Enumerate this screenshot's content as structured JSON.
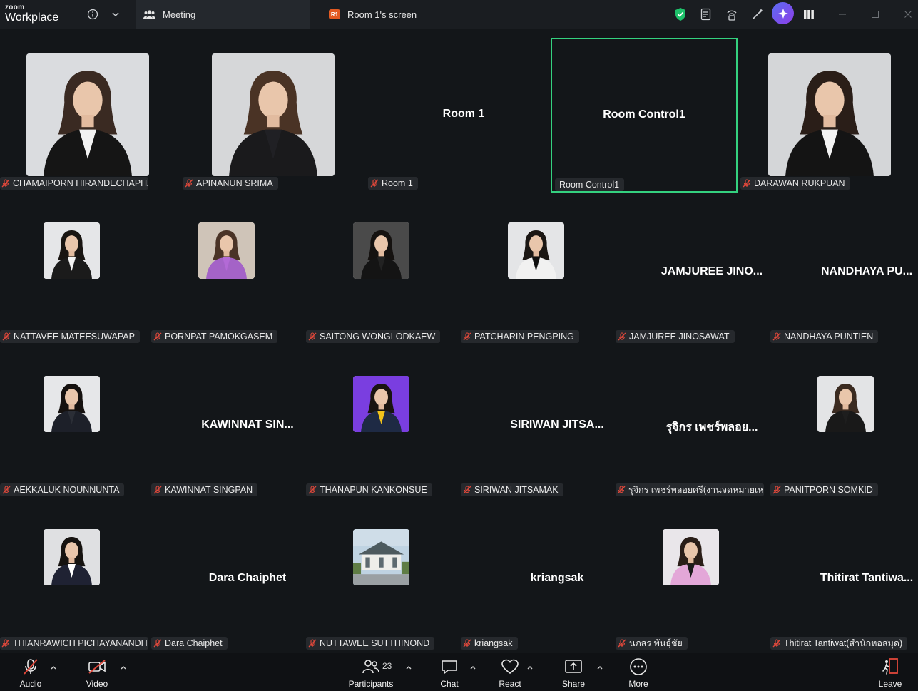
{
  "app": {
    "brand_top": "zoom",
    "brand_bottom": "Workplace",
    "tab_meeting": "Meeting",
    "tab_screen_badge": "R1",
    "tab_screen": "Room 1's screen"
  },
  "colors": {
    "highlight": "#34d17f",
    "muted_mic": "#e0483b",
    "background": "#131619"
  },
  "tiles": {
    "t1": {
      "label": "CHAMAIPORN HIRANDECHAPHAT"
    },
    "t2": {
      "label": "APINANUN SRIMA"
    },
    "t3": {
      "label": "Room 1",
      "center": "Room 1"
    },
    "t4": {
      "label": "Room Control1",
      "center": "Room Control1"
    },
    "t5": {
      "label": "DARAWAN RUKPUAN"
    },
    "t6": {
      "label": "NATTAVEE MATEESUWAPAP"
    },
    "t7": {
      "label": "PORNPAT PAMOKGASEM"
    },
    "t8": {
      "label": "SAITONG WONGLODKAEW"
    },
    "t9": {
      "label": "PATCHARIN PENGPING"
    },
    "t10": {
      "label": "JAMJUREE JINOSAWAT",
      "center": "JAMJUREE JINO..."
    },
    "t11": {
      "label": "NANDHAYA PUNTIEN",
      "center": "NANDHAYA  PU..."
    },
    "t12": {
      "label": "AEKKALUK NOUNNUNTA"
    },
    "t13": {
      "label": "KAWINNAT SINGPAN",
      "center": "KAWINNAT SIN..."
    },
    "t14": {
      "label": "THANAPUN KANKONSUE"
    },
    "t15": {
      "label": "SIRIWAN JITSAMAK",
      "center": "SIRIWAN  JITSA..."
    },
    "t16": {
      "label": "รุจิกร เพชร์พลอยศรี(งานจดหมายเหตุ...",
      "center": "รุจิกร เพชร์พลอย..."
    },
    "t17": {
      "label": "PANITPORN SOMKID"
    },
    "t18": {
      "label": "THIANRAWICH PICHAYANANDH..."
    },
    "t19": {
      "label": "Dara Chaiphet",
      "center": "Dara Chaiphet"
    },
    "t20": {
      "label": "NUTTAWEE SUTTHINOND"
    },
    "t21": {
      "label": "kriangsak",
      "center": "kriangsak"
    },
    "t22": {
      "label": "นภสร พันธุ์ชัย"
    },
    "t23": {
      "label": "Thitirat Tantiwat(สำนักหอสมุด)",
      "center": "Thitirat  Tantiwa..."
    }
  },
  "toolbar": {
    "audio": "Audio",
    "video": "Video",
    "participants": "Participants",
    "participant_count": "23",
    "chat": "Chat",
    "react": "React",
    "share": "Share",
    "more": "More",
    "leave": "Leave"
  }
}
